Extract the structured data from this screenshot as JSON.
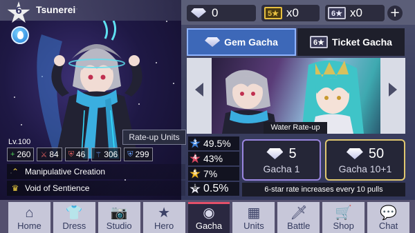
{
  "character": {
    "name": "Tsunerei",
    "rarity": "6",
    "level": "Lv.100",
    "stats": [
      {
        "icon": "plus-icon",
        "glyph": "+",
        "value": "260",
        "color": "#4fd35a"
      },
      {
        "icon": "sword-icon",
        "glyph": "⚔",
        "value": "84",
        "color": "#e06060"
      },
      {
        "icon": "shield-icon",
        "glyph": "⛨",
        "value": "46",
        "color": "#e06060"
      },
      {
        "icon": "wand-icon",
        "glyph": "⚚",
        "value": "306",
        "color": "#6aa0ff"
      },
      {
        "icon": "magic-shield-icon",
        "glyph": "⛨",
        "value": "299",
        "color": "#6aa0ff"
      }
    ],
    "skills": [
      {
        "icon": "chevron-up-icon",
        "glyph": "⌃",
        "label": "Manipulative Creation"
      },
      {
        "icon": "crown-icon",
        "glyph": "♛",
        "label": "Void of Sentience"
      }
    ],
    "rateup_label": "Rate-up Units"
  },
  "currency": {
    "gems": "0",
    "ticket5_label": "5★",
    "ticket5_count": "x0",
    "ticket6_label": "6★",
    "ticket6_count": "x0",
    "add": "+"
  },
  "tabs": {
    "gem_gacha": "Gem Gacha",
    "ticket_gacha": "Ticket Gacha",
    "ticket_icon_label": "6★"
  },
  "banner": {
    "caption": "Water Rate-up"
  },
  "rates": [
    {
      "star": "3",
      "value": "49.5%",
      "color": "#3b7fd8"
    },
    {
      "star": "4",
      "value": "43%",
      "color": "#d84860"
    },
    {
      "star": "5",
      "value": "7%",
      "color": "#e8b020"
    },
    {
      "star": "6",
      "value": "0.5%",
      "color": "#e8e8f0"
    }
  ],
  "gacha": {
    "single": {
      "cost": "5",
      "label": "Gacha 1"
    },
    "multi": {
      "cost": "50",
      "label": "Gacha 10+1"
    },
    "note": "6-star rate increases every 10 pulls"
  },
  "nav": [
    {
      "icon": "home-icon",
      "glyph": "⌂",
      "label": "Home"
    },
    {
      "icon": "shirt-icon",
      "glyph": "👕",
      "label": "Dress"
    },
    {
      "icon": "camera-icon",
      "glyph": "📷",
      "label": "Studio"
    },
    {
      "icon": "star-icon",
      "glyph": "★",
      "label": "Hero"
    },
    {
      "icon": "orb-icon",
      "glyph": "◉",
      "label": "Gacha"
    },
    {
      "icon": "grid-icon",
      "glyph": "▦",
      "label": "Units"
    },
    {
      "icon": "sword-icon",
      "glyph": "🗡",
      "label": "Battle"
    },
    {
      "icon": "cart-icon",
      "glyph": "🛒",
      "label": "Shop"
    },
    {
      "icon": "chat-icon",
      "glyph": "💬",
      "label": "Chat"
    }
  ],
  "colors": {
    "active_tab": "#3d68b8",
    "single_border": "#9a86e0",
    "multi_border": "#e0c870",
    "ticket5": "#e8c040",
    "ticket6": "#c8c8d8",
    "nav_active_accent": "#e4506a"
  }
}
